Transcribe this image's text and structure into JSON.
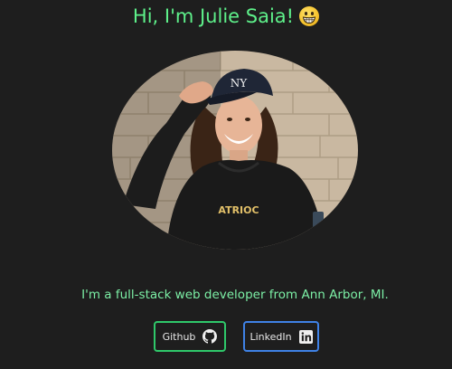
{
  "header": {
    "title": "Hi, I'm Julie Saia!",
    "emoji_icon": "grinning-face-icon"
  },
  "profile": {
    "tagline": "I'm a full-stack web developer from Ann Arbor, MI."
  },
  "links": {
    "github_label": "Github",
    "github_icon": "github-icon",
    "linkedin_label": "LinkedIn",
    "linkedin_icon": "linkedin-icon"
  },
  "colors": {
    "background": "#1e1e1e",
    "accent_green": "#5ef08a",
    "github_border": "#2fc86a",
    "linkedin_border": "#3f82e6"
  }
}
